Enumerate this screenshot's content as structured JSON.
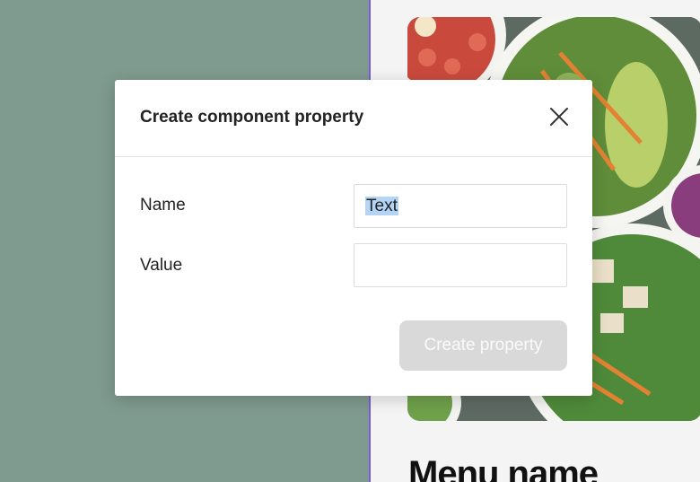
{
  "canvas": {
    "frame_title": "Menu name"
  },
  "modal": {
    "title": "Create component property",
    "fields": {
      "name_label": "Name",
      "name_value": "Text",
      "value_label": "Value",
      "value_value": ""
    },
    "create_button_label": "Create property",
    "create_button_enabled": false
  },
  "colors": {
    "background": "#7f9a8f",
    "frame_border": "#7b5cd6",
    "selection": "#b3d4f5",
    "disabled_button": "#d9d9d9"
  }
}
